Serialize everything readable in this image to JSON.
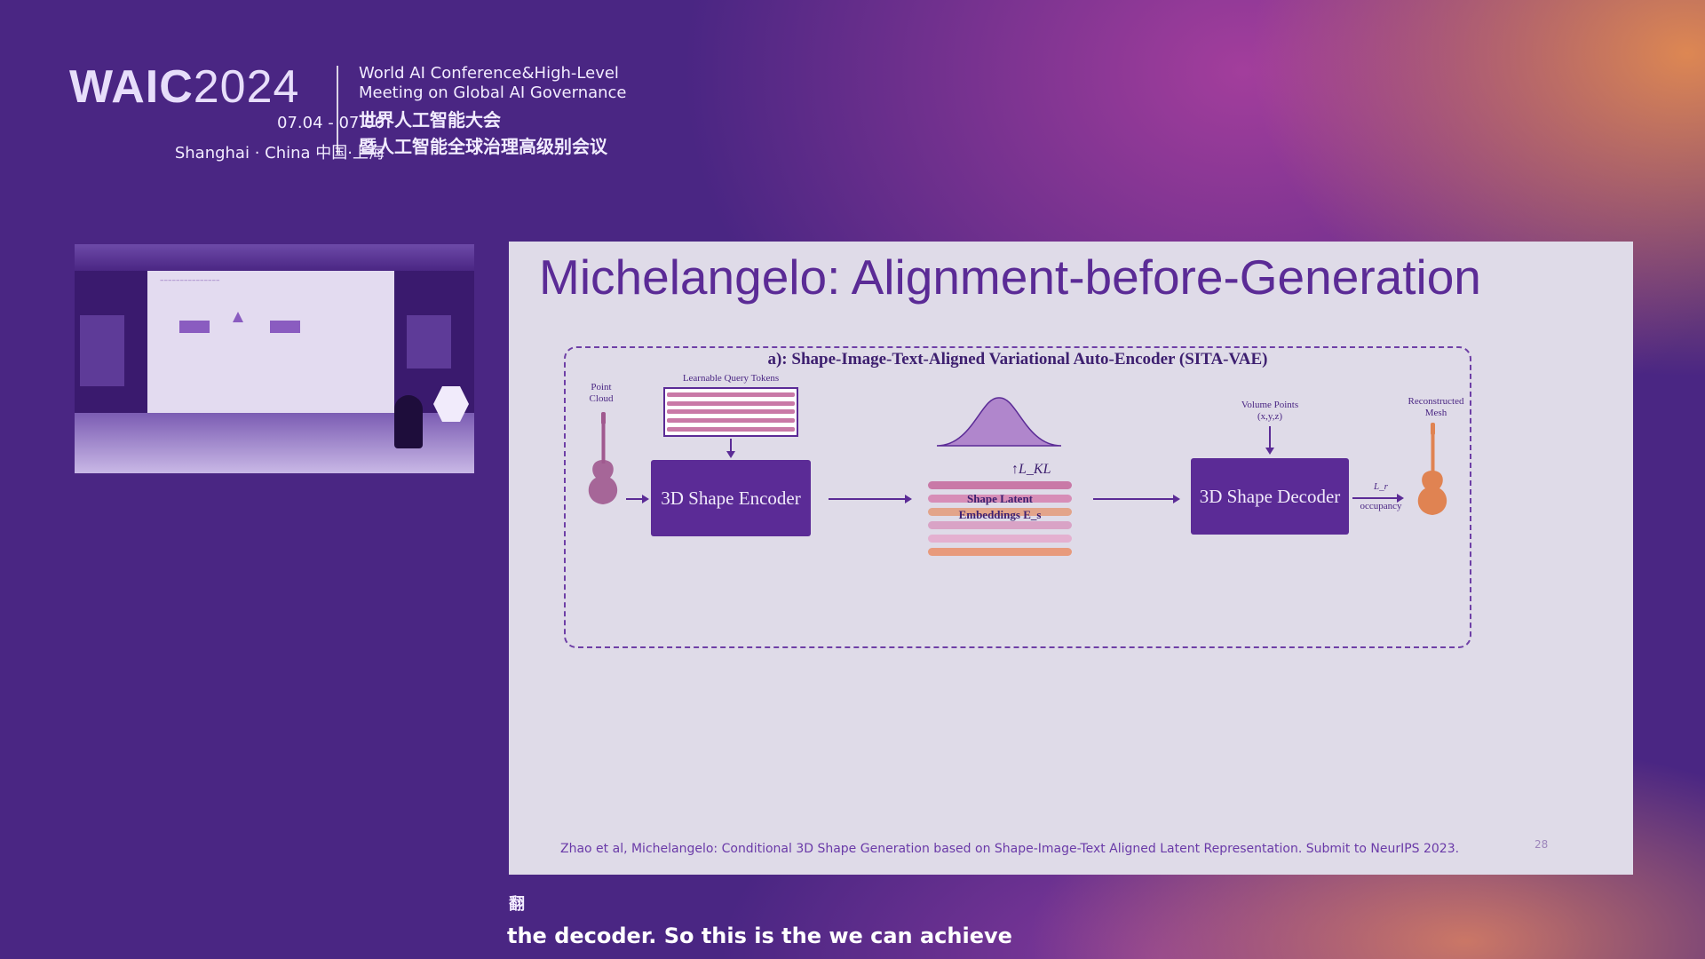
{
  "header": {
    "logo_brand": "WAIC",
    "logo_year": "2024",
    "dates": "07.04 - 07.06",
    "city": "Shanghai · China  中国·上海",
    "conference_en_line1": "World AI Conference&High-Level",
    "conference_en_line2": "Meeting on Global AI Governance",
    "conference_zh_line1": "世界人工智能大会",
    "conference_zh_line2": "暨人工智能全球治理高级别会议"
  },
  "slide": {
    "title": "Michelangelo: Alignment-before-Generation",
    "diagram_title": "a): Shape-Image-Text-Aligned Variational Auto-Encoder (SITA-VAE)",
    "point_cloud_label": "Point Cloud",
    "query_tokens_label": "Learnable Query Tokens",
    "encoder_label": "3D Shape Encoder",
    "kl_label": "L_KL",
    "latent_label_line1": "Shape Latent",
    "latent_label_line2": "Embeddings E_s",
    "volume_points_label": "Volume Points",
    "volume_points_coords": "(x,y,z)",
    "decoder_label": "3D Shape Decoder",
    "loss_label": "L_r",
    "occupancy_label": "occupancy",
    "reconstructed_label": "Reconstructed Mesh",
    "citation": "Zhao et al, Michelangelo: Conditional 3D Shape Generation based on Shape-Image-Text Aligned Latent Representation. Submit to NeurIPS 2023.",
    "page_number": "28"
  },
  "colors": {
    "accent": "#5b2b96",
    "background": "#4a2683",
    "slide_bg": "#dfdbe8",
    "latent_colors": [
      "#c979a7",
      "#d78db7",
      "#e3a48a",
      "#d9a3c6",
      "#e4b0d0",
      "#e89a7c"
    ],
    "guitar_left": "#a0598f",
    "guitar_right": "#e08352"
  },
  "subtitles": {
    "glyph": "翻",
    "text": "the decoder. So this is the we can achieve"
  }
}
